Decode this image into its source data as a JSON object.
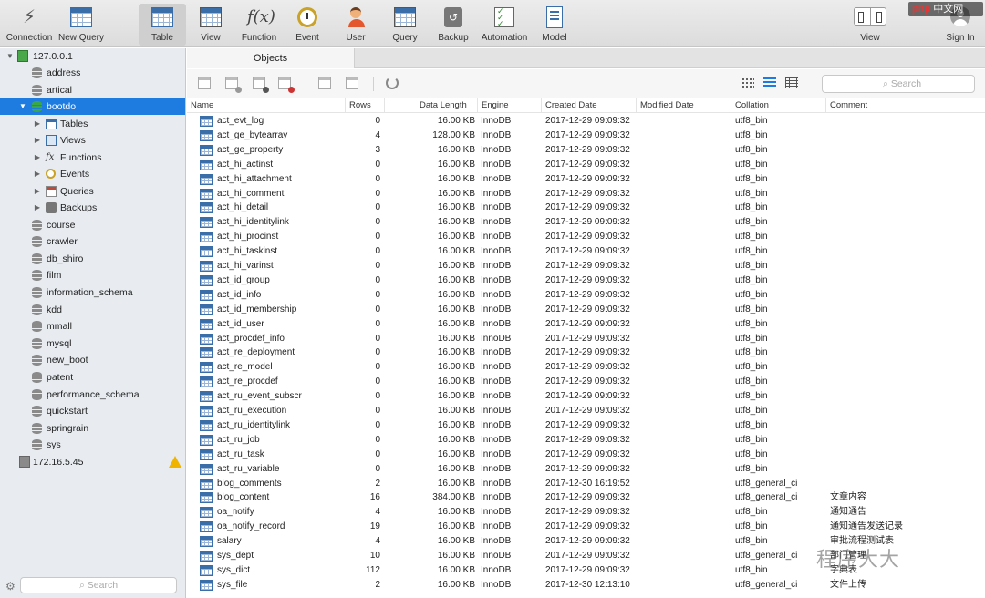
{
  "toolbar": {
    "items": [
      {
        "label": "Connection",
        "icon": "connection-icon"
      },
      {
        "label": "New Query",
        "icon": "new-query-icon"
      },
      {
        "label": "Table",
        "icon": "table-icon",
        "active": true
      },
      {
        "label": "View",
        "icon": "view-icon"
      },
      {
        "label": "Function",
        "icon": "function-icon"
      },
      {
        "label": "Event",
        "icon": "event-icon"
      },
      {
        "label": "User",
        "icon": "user-icon"
      },
      {
        "label": "Query",
        "icon": "query-icon"
      },
      {
        "label": "Backup",
        "icon": "backup-icon"
      },
      {
        "label": "Automation",
        "icon": "automation-icon"
      },
      {
        "label": "Model",
        "icon": "model-icon"
      }
    ],
    "view_label": "View",
    "signin_label": "Sign In",
    "fx_glyph": "f(x)"
  },
  "watermark_badge": {
    "prefix": "php",
    "suffix": "中文网"
  },
  "sidebar": {
    "server1": "127.0.0.1",
    "databases_before": [
      "address",
      "artical"
    ],
    "selected_db": "bootdo",
    "sub_items": [
      "Tables",
      "Views",
      "Functions",
      "Events",
      "Queries",
      "Backups"
    ],
    "databases_after": [
      "course",
      "crawler",
      "db_shiro",
      "film",
      "information_schema",
      "kdd",
      "mmall",
      "mysql",
      "new_boot",
      "patent",
      "performance_schema",
      "quickstart",
      "springrain",
      "sys"
    ],
    "server2": "172.16.5.45",
    "search_placeholder": "Search"
  },
  "tab": {
    "label": "Objects"
  },
  "objects_search_placeholder": "Search",
  "columns": [
    "Name",
    "Rows",
    "Data Length",
    "Engine",
    "Created Date",
    "Modified Date",
    "Collation",
    "Comment"
  ],
  "rows": [
    {
      "name": "act_evt_log",
      "rows": "0",
      "len": "16.00 KB",
      "engine": "InnoDB",
      "created": "2017-12-29 09:09:32",
      "collation": "utf8_bin",
      "comment": ""
    },
    {
      "name": "act_ge_bytearray",
      "rows": "4",
      "len": "128.00 KB",
      "engine": "InnoDB",
      "created": "2017-12-29 09:09:32",
      "collation": "utf8_bin",
      "comment": ""
    },
    {
      "name": "act_ge_property",
      "rows": "3",
      "len": "16.00 KB",
      "engine": "InnoDB",
      "created": "2017-12-29 09:09:32",
      "collation": "utf8_bin",
      "comment": ""
    },
    {
      "name": "act_hi_actinst",
      "rows": "0",
      "len": "16.00 KB",
      "engine": "InnoDB",
      "created": "2017-12-29 09:09:32",
      "collation": "utf8_bin",
      "comment": ""
    },
    {
      "name": "act_hi_attachment",
      "rows": "0",
      "len": "16.00 KB",
      "engine": "InnoDB",
      "created": "2017-12-29 09:09:32",
      "collation": "utf8_bin",
      "comment": ""
    },
    {
      "name": "act_hi_comment",
      "rows": "0",
      "len": "16.00 KB",
      "engine": "InnoDB",
      "created": "2017-12-29 09:09:32",
      "collation": "utf8_bin",
      "comment": ""
    },
    {
      "name": "act_hi_detail",
      "rows": "0",
      "len": "16.00 KB",
      "engine": "InnoDB",
      "created": "2017-12-29 09:09:32",
      "collation": "utf8_bin",
      "comment": ""
    },
    {
      "name": "act_hi_identitylink",
      "rows": "0",
      "len": "16.00 KB",
      "engine": "InnoDB",
      "created": "2017-12-29 09:09:32",
      "collation": "utf8_bin",
      "comment": ""
    },
    {
      "name": "act_hi_procinst",
      "rows": "0",
      "len": "16.00 KB",
      "engine": "InnoDB",
      "created": "2017-12-29 09:09:32",
      "collation": "utf8_bin",
      "comment": ""
    },
    {
      "name": "act_hi_taskinst",
      "rows": "0",
      "len": "16.00 KB",
      "engine": "InnoDB",
      "created": "2017-12-29 09:09:32",
      "collation": "utf8_bin",
      "comment": ""
    },
    {
      "name": "act_hi_varinst",
      "rows": "0",
      "len": "16.00 KB",
      "engine": "InnoDB",
      "created": "2017-12-29 09:09:32",
      "collation": "utf8_bin",
      "comment": ""
    },
    {
      "name": "act_id_group",
      "rows": "0",
      "len": "16.00 KB",
      "engine": "InnoDB",
      "created": "2017-12-29 09:09:32",
      "collation": "utf8_bin",
      "comment": ""
    },
    {
      "name": "act_id_info",
      "rows": "0",
      "len": "16.00 KB",
      "engine": "InnoDB",
      "created": "2017-12-29 09:09:32",
      "collation": "utf8_bin",
      "comment": ""
    },
    {
      "name": "act_id_membership",
      "rows": "0",
      "len": "16.00 KB",
      "engine": "InnoDB",
      "created": "2017-12-29 09:09:32",
      "collation": "utf8_bin",
      "comment": ""
    },
    {
      "name": "act_id_user",
      "rows": "0",
      "len": "16.00 KB",
      "engine": "InnoDB",
      "created": "2017-12-29 09:09:32",
      "collation": "utf8_bin",
      "comment": ""
    },
    {
      "name": "act_procdef_info",
      "rows": "0",
      "len": "16.00 KB",
      "engine": "InnoDB",
      "created": "2017-12-29 09:09:32",
      "collation": "utf8_bin",
      "comment": ""
    },
    {
      "name": "act_re_deployment",
      "rows": "0",
      "len": "16.00 KB",
      "engine": "InnoDB",
      "created": "2017-12-29 09:09:32",
      "collation": "utf8_bin",
      "comment": ""
    },
    {
      "name": "act_re_model",
      "rows": "0",
      "len": "16.00 KB",
      "engine": "InnoDB",
      "created": "2017-12-29 09:09:32",
      "collation": "utf8_bin",
      "comment": ""
    },
    {
      "name": "act_re_procdef",
      "rows": "0",
      "len": "16.00 KB",
      "engine": "InnoDB",
      "created": "2017-12-29 09:09:32",
      "collation": "utf8_bin",
      "comment": ""
    },
    {
      "name": "act_ru_event_subscr",
      "rows": "0",
      "len": "16.00 KB",
      "engine": "InnoDB",
      "created": "2017-12-29 09:09:32",
      "collation": "utf8_bin",
      "comment": ""
    },
    {
      "name": "act_ru_execution",
      "rows": "0",
      "len": "16.00 KB",
      "engine": "InnoDB",
      "created": "2017-12-29 09:09:32",
      "collation": "utf8_bin",
      "comment": ""
    },
    {
      "name": "act_ru_identitylink",
      "rows": "0",
      "len": "16.00 KB",
      "engine": "InnoDB",
      "created": "2017-12-29 09:09:32",
      "collation": "utf8_bin",
      "comment": ""
    },
    {
      "name": "act_ru_job",
      "rows": "0",
      "len": "16.00 KB",
      "engine": "InnoDB",
      "created": "2017-12-29 09:09:32",
      "collation": "utf8_bin",
      "comment": ""
    },
    {
      "name": "act_ru_task",
      "rows": "0",
      "len": "16.00 KB",
      "engine": "InnoDB",
      "created": "2017-12-29 09:09:32",
      "collation": "utf8_bin",
      "comment": ""
    },
    {
      "name": "act_ru_variable",
      "rows": "0",
      "len": "16.00 KB",
      "engine": "InnoDB",
      "created": "2017-12-29 09:09:32",
      "collation": "utf8_bin",
      "comment": ""
    },
    {
      "name": "blog_comments",
      "rows": "2",
      "len": "16.00 KB",
      "engine": "InnoDB",
      "created": "2017-12-30 16:19:52",
      "collation": "utf8_general_ci",
      "comment": ""
    },
    {
      "name": "blog_content",
      "rows": "16",
      "len": "384.00 KB",
      "engine": "InnoDB",
      "created": "2017-12-29 09:09:32",
      "collation": "utf8_general_ci",
      "comment": "文章内容"
    },
    {
      "name": "oa_notify",
      "rows": "4",
      "len": "16.00 KB",
      "engine": "InnoDB",
      "created": "2017-12-29 09:09:32",
      "collation": "utf8_bin",
      "comment": "通知通告"
    },
    {
      "name": "oa_notify_record",
      "rows": "19",
      "len": "16.00 KB",
      "engine": "InnoDB",
      "created": "2017-12-29 09:09:32",
      "collation": "utf8_bin",
      "comment": "通知通告发送记录"
    },
    {
      "name": "salary",
      "rows": "4",
      "len": "16.00 KB",
      "engine": "InnoDB",
      "created": "2017-12-29 09:09:32",
      "collation": "utf8_bin",
      "comment": "审批流程测试表"
    },
    {
      "name": "sys_dept",
      "rows": "10",
      "len": "16.00 KB",
      "engine": "InnoDB",
      "created": "2017-12-29 09:09:32",
      "collation": "utf8_general_ci",
      "comment": "部门管理"
    },
    {
      "name": "sys_dict",
      "rows": "112",
      "len": "16.00 KB",
      "engine": "InnoDB",
      "created": "2017-12-29 09:09:32",
      "collation": "utf8_bin",
      "comment": "字典表"
    },
    {
      "name": "sys_file",
      "rows": "2",
      "len": "16.00 KB",
      "engine": "InnoDB",
      "created": "2017-12-30 12:13:10",
      "collation": "utf8_general_ci",
      "comment": "文件上传"
    }
  ],
  "watermark": "程序大大"
}
